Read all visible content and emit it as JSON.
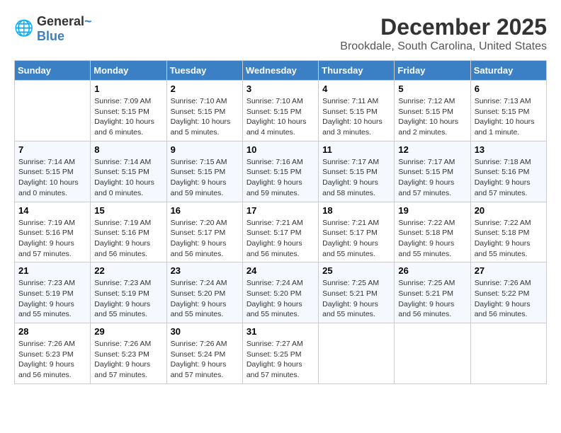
{
  "logo": {
    "general": "General",
    "blue": "Blue"
  },
  "header": {
    "month_year": "December 2025",
    "location": "Brookdale, South Carolina, United States"
  },
  "days_of_week": [
    "Sunday",
    "Monday",
    "Tuesday",
    "Wednesday",
    "Thursday",
    "Friday",
    "Saturday"
  ],
  "weeks": [
    [
      {
        "day": "",
        "content": ""
      },
      {
        "day": "1",
        "content": "Sunrise: 7:09 AM\nSunset: 5:15 PM\nDaylight: 10 hours\nand 6 minutes."
      },
      {
        "day": "2",
        "content": "Sunrise: 7:10 AM\nSunset: 5:15 PM\nDaylight: 10 hours\nand 5 minutes."
      },
      {
        "day": "3",
        "content": "Sunrise: 7:10 AM\nSunset: 5:15 PM\nDaylight: 10 hours\nand 4 minutes."
      },
      {
        "day": "4",
        "content": "Sunrise: 7:11 AM\nSunset: 5:15 PM\nDaylight: 10 hours\nand 3 minutes."
      },
      {
        "day": "5",
        "content": "Sunrise: 7:12 AM\nSunset: 5:15 PM\nDaylight: 10 hours\nand 2 minutes."
      },
      {
        "day": "6",
        "content": "Sunrise: 7:13 AM\nSunset: 5:15 PM\nDaylight: 10 hours\nand 1 minute."
      }
    ],
    [
      {
        "day": "7",
        "content": "Sunrise: 7:14 AM\nSunset: 5:15 PM\nDaylight: 10 hours\nand 0 minutes."
      },
      {
        "day": "8",
        "content": "Sunrise: 7:14 AM\nSunset: 5:15 PM\nDaylight: 10 hours\nand 0 minutes."
      },
      {
        "day": "9",
        "content": "Sunrise: 7:15 AM\nSunset: 5:15 PM\nDaylight: 9 hours\nand 59 minutes."
      },
      {
        "day": "10",
        "content": "Sunrise: 7:16 AM\nSunset: 5:15 PM\nDaylight: 9 hours\nand 59 minutes."
      },
      {
        "day": "11",
        "content": "Sunrise: 7:17 AM\nSunset: 5:15 PM\nDaylight: 9 hours\nand 58 minutes."
      },
      {
        "day": "12",
        "content": "Sunrise: 7:17 AM\nSunset: 5:15 PM\nDaylight: 9 hours\nand 57 minutes."
      },
      {
        "day": "13",
        "content": "Sunrise: 7:18 AM\nSunset: 5:16 PM\nDaylight: 9 hours\nand 57 minutes."
      }
    ],
    [
      {
        "day": "14",
        "content": "Sunrise: 7:19 AM\nSunset: 5:16 PM\nDaylight: 9 hours\nand 57 minutes."
      },
      {
        "day": "15",
        "content": "Sunrise: 7:19 AM\nSunset: 5:16 PM\nDaylight: 9 hours\nand 56 minutes."
      },
      {
        "day": "16",
        "content": "Sunrise: 7:20 AM\nSunset: 5:17 PM\nDaylight: 9 hours\nand 56 minutes."
      },
      {
        "day": "17",
        "content": "Sunrise: 7:21 AM\nSunset: 5:17 PM\nDaylight: 9 hours\nand 56 minutes."
      },
      {
        "day": "18",
        "content": "Sunrise: 7:21 AM\nSunset: 5:17 PM\nDaylight: 9 hours\nand 55 minutes."
      },
      {
        "day": "19",
        "content": "Sunrise: 7:22 AM\nSunset: 5:18 PM\nDaylight: 9 hours\nand 55 minutes."
      },
      {
        "day": "20",
        "content": "Sunrise: 7:22 AM\nSunset: 5:18 PM\nDaylight: 9 hours\nand 55 minutes."
      }
    ],
    [
      {
        "day": "21",
        "content": "Sunrise: 7:23 AM\nSunset: 5:19 PM\nDaylight: 9 hours\nand 55 minutes."
      },
      {
        "day": "22",
        "content": "Sunrise: 7:23 AM\nSunset: 5:19 PM\nDaylight: 9 hours\nand 55 minutes."
      },
      {
        "day": "23",
        "content": "Sunrise: 7:24 AM\nSunset: 5:20 PM\nDaylight: 9 hours\nand 55 minutes."
      },
      {
        "day": "24",
        "content": "Sunrise: 7:24 AM\nSunset: 5:20 PM\nDaylight: 9 hours\nand 55 minutes."
      },
      {
        "day": "25",
        "content": "Sunrise: 7:25 AM\nSunset: 5:21 PM\nDaylight: 9 hours\nand 55 minutes."
      },
      {
        "day": "26",
        "content": "Sunrise: 7:25 AM\nSunset: 5:21 PM\nDaylight: 9 hours\nand 56 minutes."
      },
      {
        "day": "27",
        "content": "Sunrise: 7:26 AM\nSunset: 5:22 PM\nDaylight: 9 hours\nand 56 minutes."
      }
    ],
    [
      {
        "day": "28",
        "content": "Sunrise: 7:26 AM\nSunset: 5:23 PM\nDaylight: 9 hours\nand 56 minutes."
      },
      {
        "day": "29",
        "content": "Sunrise: 7:26 AM\nSunset: 5:23 PM\nDaylight: 9 hours\nand 57 minutes."
      },
      {
        "day": "30",
        "content": "Sunrise: 7:26 AM\nSunset: 5:24 PM\nDaylight: 9 hours\nand 57 minutes."
      },
      {
        "day": "31",
        "content": "Sunrise: 7:27 AM\nSunset: 5:25 PM\nDaylight: 9 hours\nand 57 minutes."
      },
      {
        "day": "",
        "content": ""
      },
      {
        "day": "",
        "content": ""
      },
      {
        "day": "",
        "content": ""
      }
    ]
  ]
}
